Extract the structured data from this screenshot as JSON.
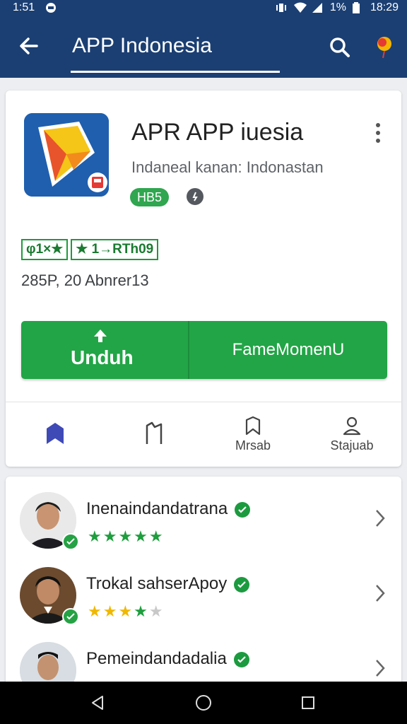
{
  "status_bar": {
    "time_left": "1:51",
    "battery": "1%",
    "time_right": "18:29"
  },
  "app_bar": {
    "title": "APP Indonesia"
  },
  "app": {
    "name": "APR APP iuesia",
    "subtitle": "Indaneal kanan: Indonastan",
    "pill": "HB5",
    "rating_label_1": "φ1×★",
    "rating_label_2": "★ 1→RTh09",
    "meta": "285P,  20 Abnrer13",
    "install_label": "Unduh",
    "secondary_label": "FameMomenU"
  },
  "tabs": [
    {
      "label": ""
    },
    {
      "label": ""
    },
    {
      "label": "Mrsab"
    },
    {
      "label": "Stajuab"
    }
  ],
  "reviews": [
    {
      "name": "Inenaindandatrana",
      "stars": 5,
      "star_text": "★★★★★"
    },
    {
      "name": "Trokal sahserApoy",
      "stars": 4,
      "star_text": "★★★★"
    },
    {
      "name": "Pemeindandadalia",
      "stars": 0,
      "star_text": ""
    }
  ],
  "colors": {
    "app_bar": "#1b3f73",
    "green": "#22a546",
    "accent_blue": "#3f4ab7"
  }
}
